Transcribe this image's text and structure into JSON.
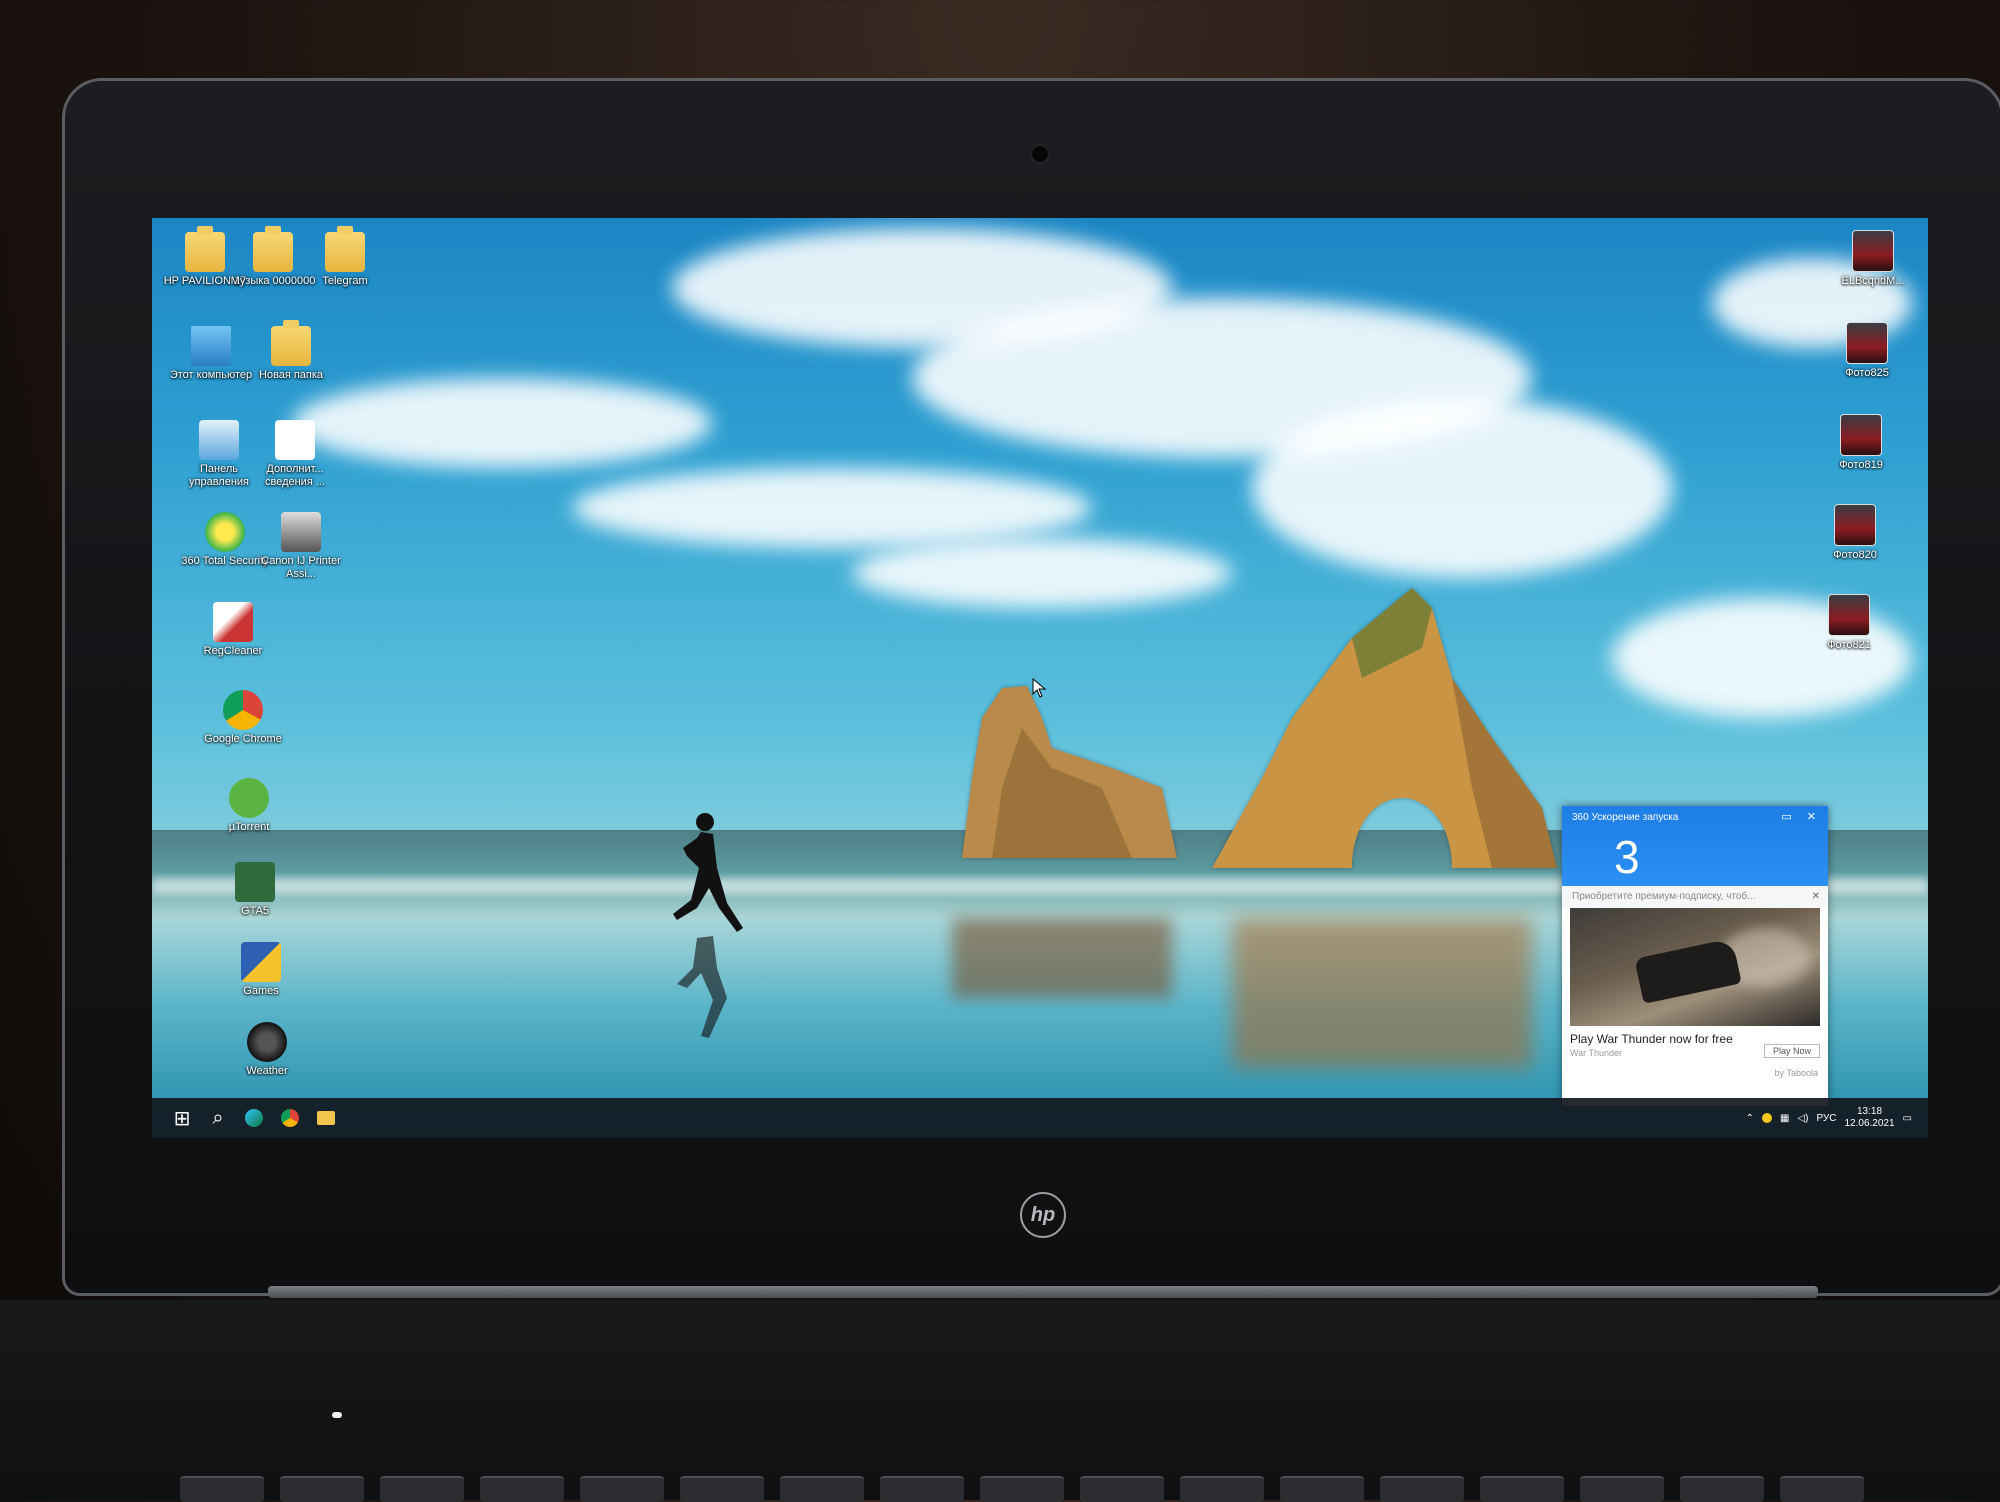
{
  "device": {
    "brand": "hp"
  },
  "desktop": {
    "icons_left": [
      {
        "id": "hp-pavilion",
        "label": "HP PAVILION 17",
        "icon": "folder-icon"
      },
      {
        "id": "muzyka",
        "label": "Музыка 0000000",
        "icon": "folder-icon"
      },
      {
        "id": "telegram",
        "label": "Telegram",
        "icon": "folder-icon"
      },
      {
        "id": "this-pc",
        "label": "Этот компьютер",
        "icon": "computer-icon"
      },
      {
        "id": "new-folder",
        "label": "Новая папка",
        "icon": "folder-icon"
      },
      {
        "id": "control-panel",
        "label": "Панель управления",
        "icon": "control-panel-icon"
      },
      {
        "id": "extra-info",
        "label": "Дополнит... сведения ...",
        "icon": "chrome-shortcut-icon"
      },
      {
        "id": "360-total",
        "label": "360 Total Security",
        "icon": "shield-plus-icon"
      },
      {
        "id": "canon",
        "label": "Canon IJ Printer Assi...",
        "icon": "printer-tools-icon"
      },
      {
        "id": "regcleaner",
        "label": "RegCleaner",
        "icon": "regcleaner-icon"
      },
      {
        "id": "chrome",
        "label": "Google Chrome",
        "icon": "chrome-icon"
      },
      {
        "id": "utorrent",
        "label": "µTorrent",
        "icon": "utorrent-icon"
      },
      {
        "id": "gta5",
        "label": "GTA5",
        "icon": "gta-icon"
      },
      {
        "id": "games",
        "label": "Games",
        "icon": "games-icon"
      },
      {
        "id": "weather",
        "label": "Weather",
        "icon": "weather-icon"
      }
    ],
    "icons_right": [
      {
        "id": "elb",
        "label": "ELBcqndM...",
        "icon": "image-file-icon"
      },
      {
        "id": "foto825",
        "label": "Фото825",
        "icon": "image-file-icon"
      },
      {
        "id": "foto819",
        "label": "Фото819",
        "icon": "image-file-icon"
      },
      {
        "id": "foto820",
        "label": "Фото820",
        "icon": "image-file-icon"
      },
      {
        "id": "foto821",
        "label": "Фото821",
        "icon": "image-file-icon"
      }
    ]
  },
  "popup": {
    "title": "360 Ускорение запуска",
    "count": "3",
    "subtitle": "Приобретите премиум-подписку, чтоб...",
    "ad_title": "Play War Thunder now for free",
    "ad_source": "War Thunder",
    "cta": "Play Now",
    "by": "by Taboola",
    "controls": "▭ ✕"
  },
  "taskbar": {
    "buttons": [
      "windows-start-icon",
      "search-icon",
      "edge-icon",
      "chrome-icon",
      "file-explorer-icon"
    ],
    "tray_lang": "РУС",
    "clock_time": "13:18",
    "clock_date": "12.06.2021"
  }
}
